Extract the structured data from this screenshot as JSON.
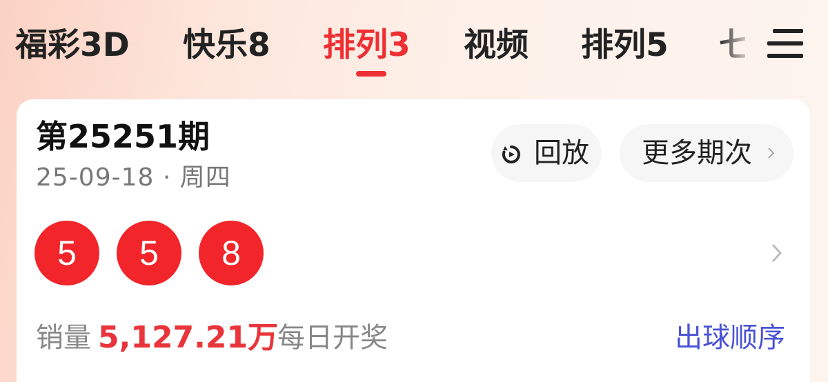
{
  "tabs": [
    {
      "label": "福彩3D"
    },
    {
      "label": "快乐8"
    },
    {
      "label": "排列3",
      "active": true
    },
    {
      "label": "视频"
    },
    {
      "label": "排列5"
    },
    {
      "label": "七"
    }
  ],
  "icons": {
    "menu": "menu-icon",
    "replay": "replay-icon",
    "more": "chevron-right-icon"
  },
  "draw": {
    "period": "第25251期",
    "date": "25-09-18 · 周四",
    "replay_label": "回放",
    "more_label": "更多期次",
    "numbers": [
      "5",
      "5",
      "8"
    ],
    "sales_label": "销量",
    "sales_value": "5,127.21万",
    "schedule": "每日开奖",
    "order_link": "出球顺序"
  },
  "colors": {
    "accent": "#ee2f33",
    "ball": "#f1252a",
    "link": "#4a52d6"
  }
}
